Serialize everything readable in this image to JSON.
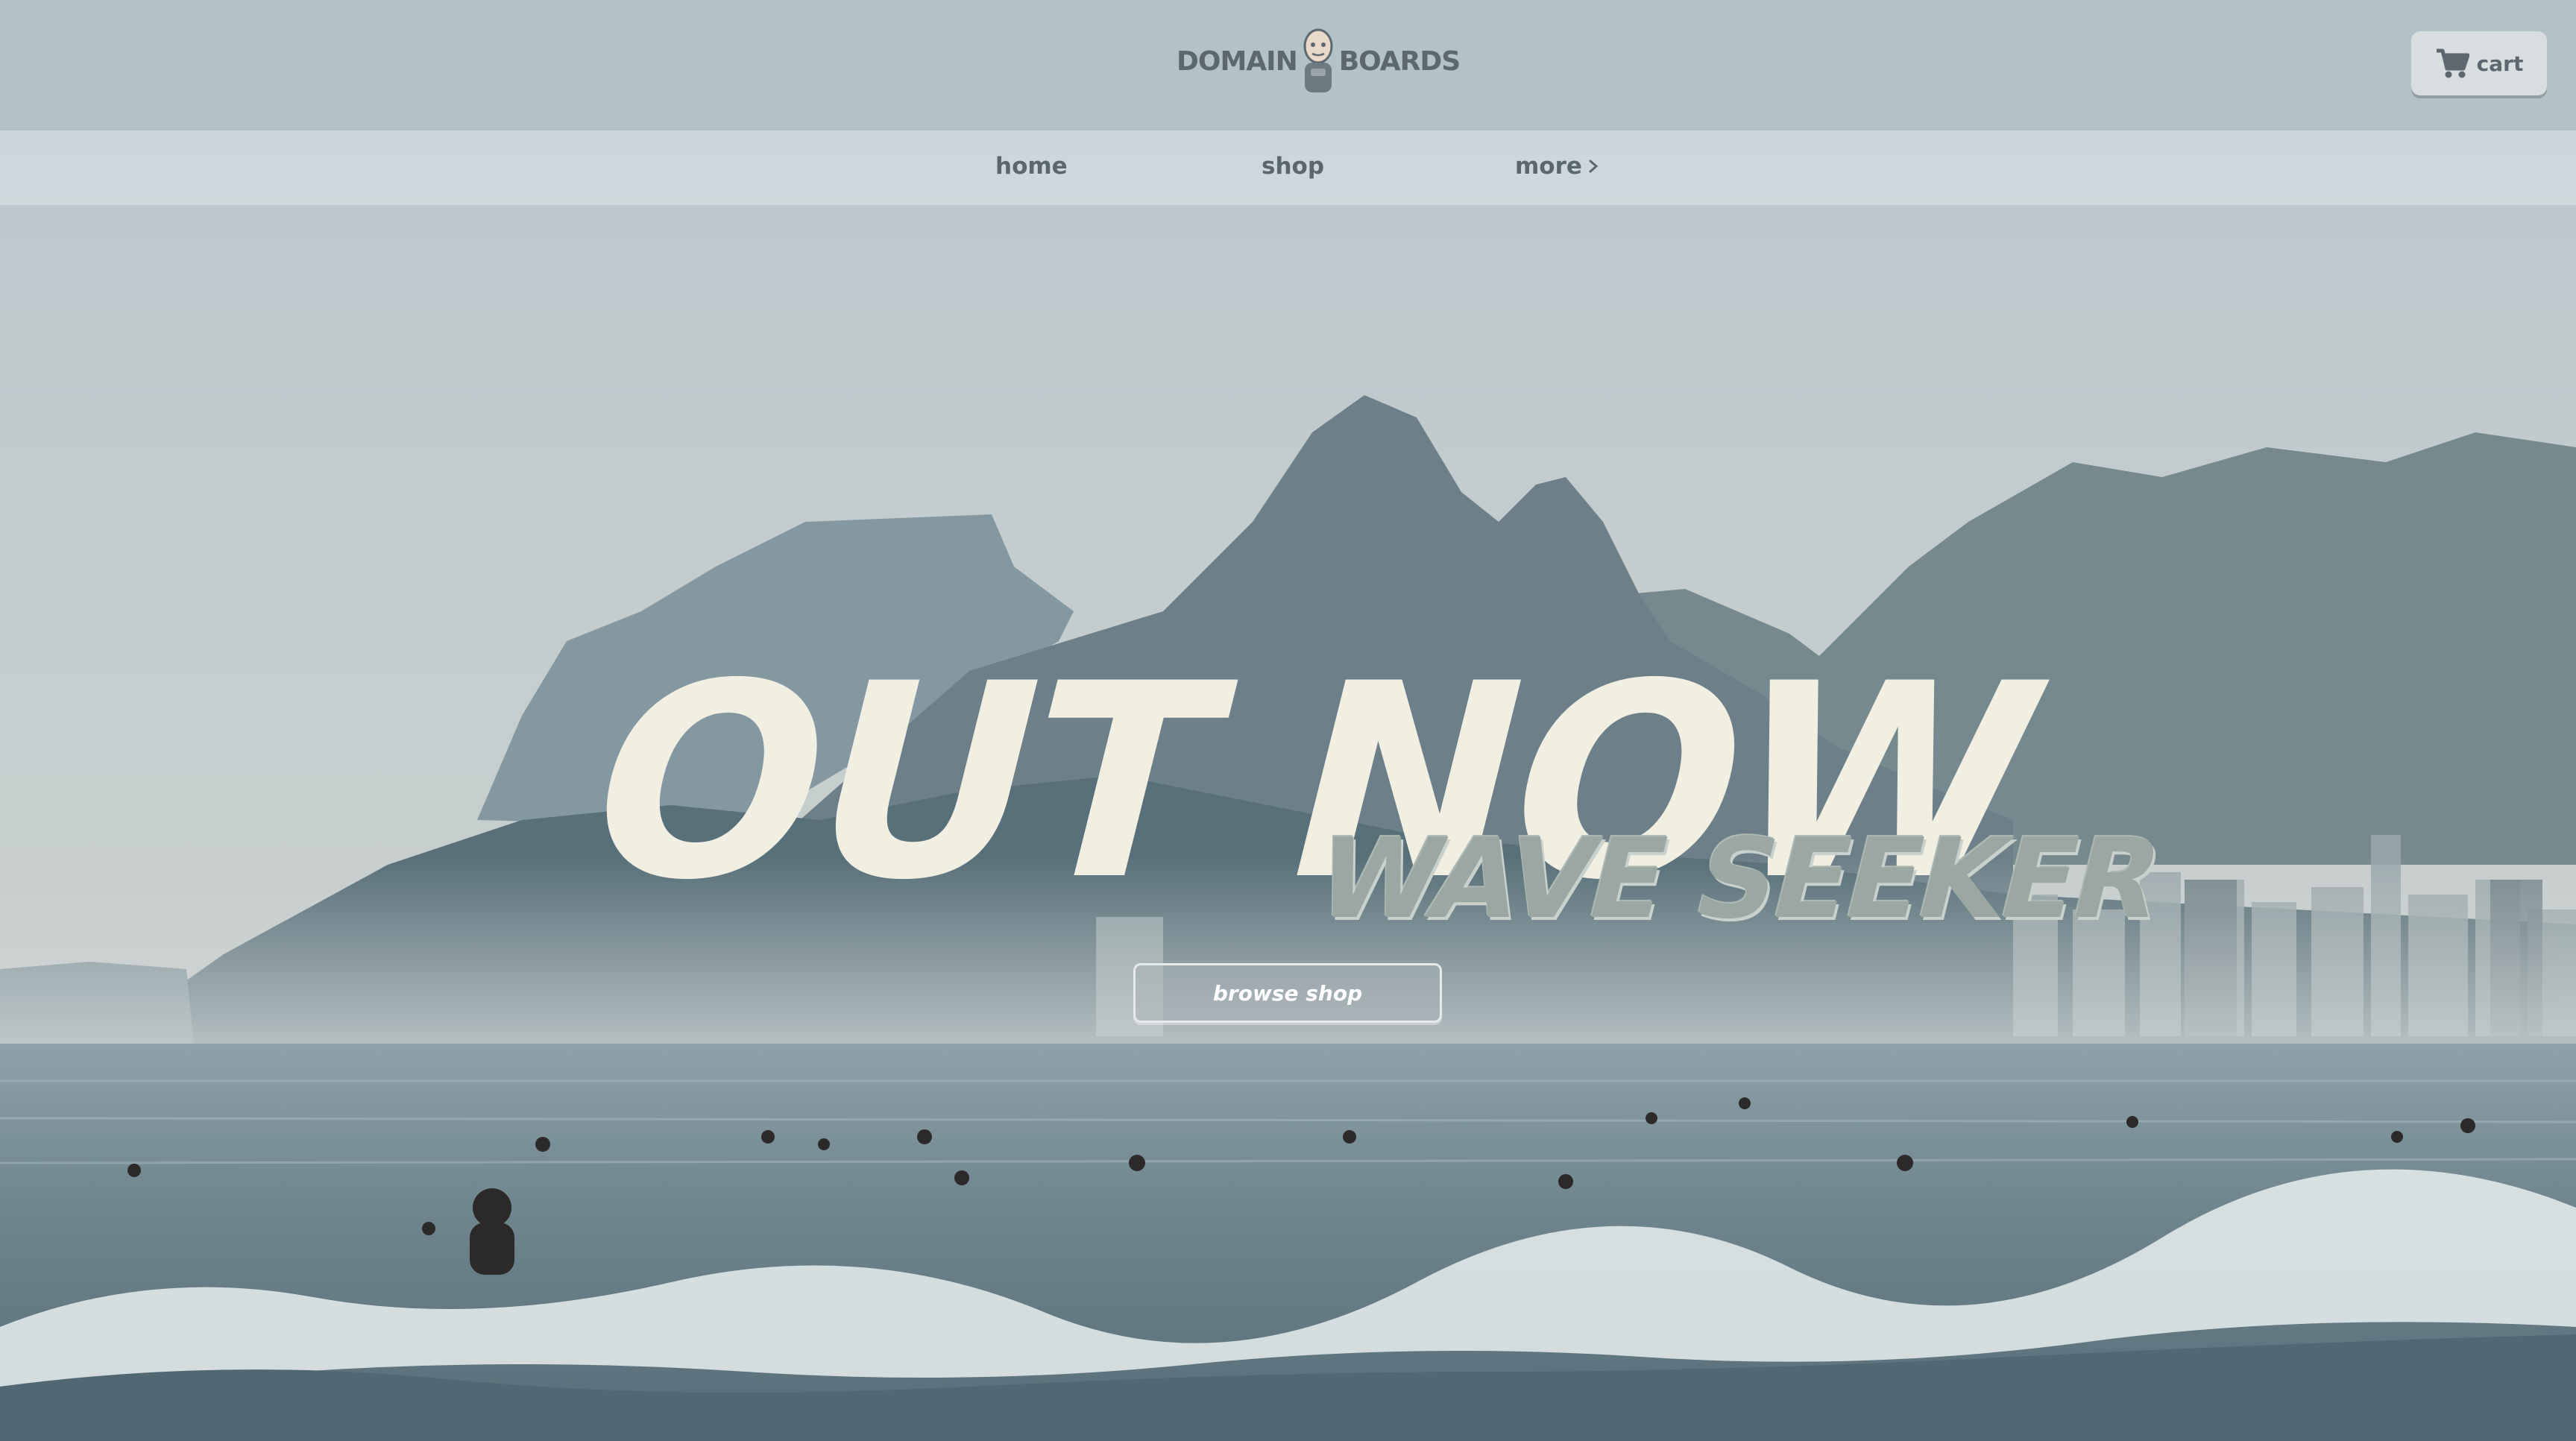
{
  "header": {
    "logo": {
      "left_word": "DOMAIN",
      "right_word": "BOARDS",
      "mascot_icon": "mascot-icon"
    },
    "cart": {
      "label": "cart",
      "icon": "cart-icon"
    }
  },
  "nav": {
    "items": [
      {
        "label": "home"
      },
      {
        "label": "shop"
      },
      {
        "label": "more",
        "icon": "chevron-right-icon"
      }
    ]
  },
  "hero": {
    "title": "OUT NOW",
    "subtitle": "WAVE SEEKER",
    "cta_label": "browse shop"
  },
  "colors": {
    "title": "#f1eee2",
    "subtitle": "#9aa7a2",
    "nav_text": "#5a6770",
    "cta_text": "#ffffff"
  }
}
